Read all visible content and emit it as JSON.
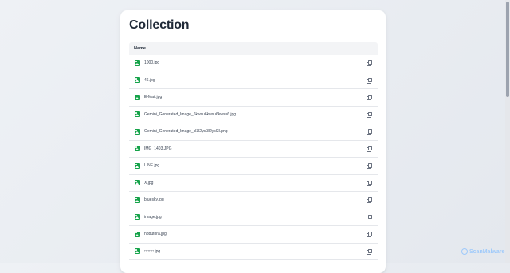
{
  "page": {
    "title": "Collection"
  },
  "table": {
    "header_name": "Name",
    "rows": [
      {
        "name": "1000.jpg",
        "icon": "image-icon",
        "action_icon": "copy-icon"
      },
      {
        "name": "46.jpg",
        "icon": "image-icon",
        "action_icon": "copy-icon"
      },
      {
        "name": "E-Mail.jpg",
        "icon": "image-icon",
        "action_icon": "copy-icon"
      },
      {
        "name": "Gemini_Generated_Image_6kwsu6kwsu6kwsu6.jpg",
        "icon": "image-icon",
        "action_icon": "copy-icon"
      },
      {
        "name": "Gemini_Generated_Image_sl3l2ysl3l2ysl3l.png",
        "icon": "image-icon",
        "action_icon": "copy-icon"
      },
      {
        "name": "IMG_1403.JPG",
        "icon": "image-icon",
        "action_icon": "copy-icon"
      },
      {
        "name": "LINE.jpg",
        "icon": "image-icon",
        "action_icon": "copy-icon"
      },
      {
        "name": "X.jpg",
        "icon": "image-icon",
        "action_icon": "copy-icon"
      },
      {
        "name": "bluesky.jpg",
        "icon": "image-icon",
        "action_icon": "copy-icon"
      },
      {
        "name": "image.jpg",
        "icon": "image-icon",
        "action_icon": "copy-icon"
      },
      {
        "name": "nobutora.jpg",
        "icon": "image-icon",
        "action_icon": "copy-icon"
      },
      {
        "name": "□□□□.jpg",
        "icon": "image-icon",
        "action_icon": "copy-icon"
      }
    ]
  },
  "watermark": {
    "text": "ScanMalware"
  },
  "colors": {
    "icon_green": "#16a34a",
    "header_bg": "#f3f4f6",
    "watermark": "#93c5fd"
  }
}
